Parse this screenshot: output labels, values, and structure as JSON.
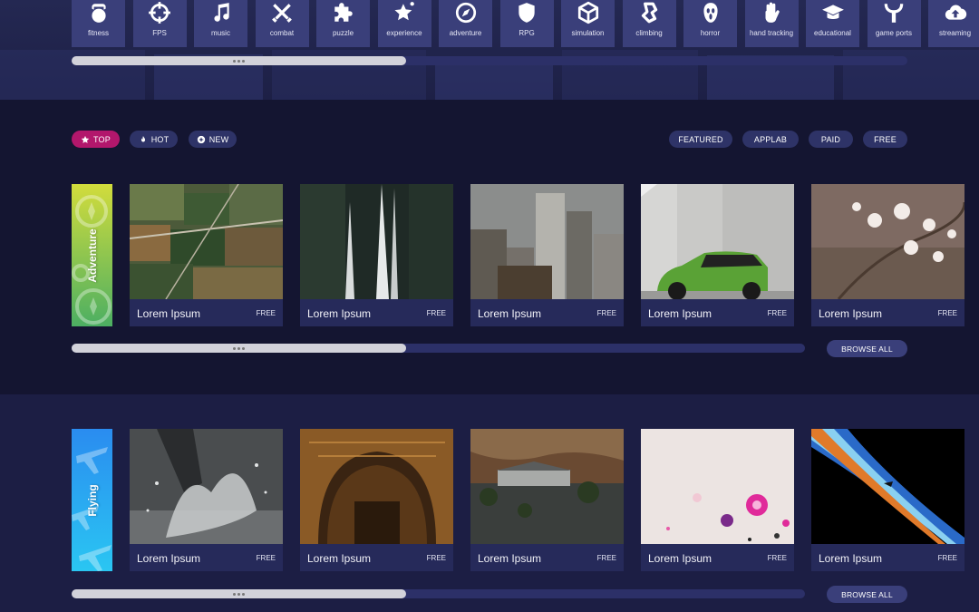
{
  "genres": [
    {
      "label": "fitness",
      "icon": "kettlebell-icon"
    },
    {
      "label": "FPS",
      "icon": "crosshair-icon"
    },
    {
      "label": "music",
      "icon": "music-note-icon"
    },
    {
      "label": "combat",
      "icon": "crossed-swords-icon"
    },
    {
      "label": "puzzle",
      "icon": "puzzle-piece-icon"
    },
    {
      "label": "experience",
      "icon": "star-icon"
    },
    {
      "label": "adventure",
      "icon": "compass-icon"
    },
    {
      "label": "RPG",
      "icon": "shield-icon"
    },
    {
      "label": "simulation",
      "icon": "cube-icon"
    },
    {
      "label": "climbing",
      "icon": "climbing-hold-icon"
    },
    {
      "label": "horror",
      "icon": "ghost-mask-icon"
    },
    {
      "label": "hand tracking",
      "icon": "hand-icon"
    },
    {
      "label": "educational",
      "icon": "graduation-cap-icon"
    },
    {
      "label": "game ports",
      "icon": "game-port-icon"
    },
    {
      "label": "streaming",
      "icon": "cloud-upload-icon"
    }
  ],
  "sort_tabs": [
    {
      "label": "TOP",
      "icon": "star-icon",
      "active": true
    },
    {
      "label": "HOT",
      "icon": "flame-icon",
      "active": false
    },
    {
      "label": "NEW",
      "icon": "sparkle-icon",
      "active": false
    }
  ],
  "store_filters": [
    "FEATURED",
    "APPLAB",
    "PAID",
    "FREE"
  ],
  "sections": [
    {
      "category": "Adventure",
      "colors": [
        "#d2dc3c",
        "#4caf62"
      ],
      "cards": [
        {
          "title": "Lorem Ipsum",
          "price": "FREE",
          "scene": "aerial-fields"
        },
        {
          "title": "Lorem Ipsum",
          "price": "FREE",
          "scene": "waterfall"
        },
        {
          "title": "Lorem Ipsum",
          "price": "FREE",
          "scene": "city-skyline"
        },
        {
          "title": "Lorem Ipsum",
          "price": "FREE",
          "scene": "green-car"
        },
        {
          "title": "Lorem Ipsum",
          "price": "FREE",
          "scene": "cherry-blossom"
        }
      ],
      "browse_label": "BROWSE ALL"
    },
    {
      "category": "Flying",
      "colors": [
        "#2a8cf0",
        "#2ac6f2"
      ],
      "cards": [
        {
          "title": "Lorem Ipsum",
          "price": "FREE",
          "scene": "water-splash"
        },
        {
          "title": "Lorem Ipsum",
          "price": "FREE",
          "scene": "stone-arch"
        },
        {
          "title": "Lorem Ipsum",
          "price": "FREE",
          "scene": "lake-house"
        },
        {
          "title": "Lorem Ipsum",
          "price": "FREE",
          "scene": "paint-drops"
        },
        {
          "title": "Lorem Ipsum",
          "price": "FREE",
          "scene": "earth-horizon"
        }
      ],
      "browse_label": "BROWSE ALL"
    }
  ],
  "colors": {
    "accent": "#b2176c",
    "pill": "#2e3367",
    "tile": "#3a3f7a",
    "background": "#141531"
  }
}
